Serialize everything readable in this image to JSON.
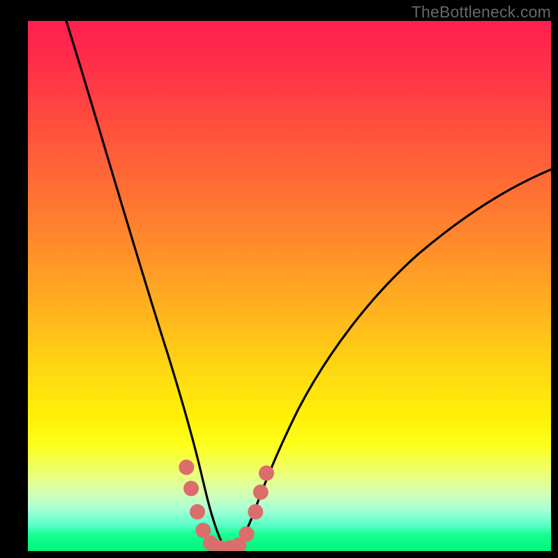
{
  "watermark": "TheBottleneck.com",
  "colors": {
    "page_bg": "#000000",
    "curve": "#000000",
    "marker_fill": "#db6d6d",
    "gradient_stops": [
      "#ff1f4f",
      "#ff2e49",
      "#ff4a3f",
      "#ff6a35",
      "#ff8b2b",
      "#ffb41e",
      "#ffd812",
      "#fff108",
      "#fdff1a",
      "#f4ff4d",
      "#eaff80",
      "#d4ffb3",
      "#a9ffd6",
      "#5cffc9",
      "#14ff8f",
      "#00f57a"
    ]
  },
  "chart_data": {
    "type": "line",
    "title": "",
    "xlabel": "",
    "ylabel": "",
    "xlim": [
      0,
      100
    ],
    "ylim": [
      0,
      100
    ],
    "description": "V-shaped bottleneck curve against a vertical heat-gradient background (red = high bottleneck at top, green = low/no bottleneck at bottom). Two monotone branches descend from the top edge toward a flat minimum near x≈37 at y≈0, with the right branch rising more gently than the left.",
    "series": [
      {
        "name": "left-branch",
        "x": [
          7.3,
          10,
          14,
          18,
          22,
          25,
          27,
          29,
          30.5,
          32,
          33.5,
          35,
          37
        ],
        "y": [
          100,
          90,
          76,
          62,
          48,
          37,
          29,
          21,
          15,
          9,
          4.5,
          1.5,
          0
        ]
      },
      {
        "name": "right-branch",
        "x": [
          40,
          41.5,
          43,
          45,
          48,
          52,
          58,
          66,
          76,
          88,
          100
        ],
        "y": [
          0,
          1.5,
          4,
          8,
          14,
          21,
          30,
          40,
          50,
          58.5,
          65
        ]
      }
    ],
    "markers": {
      "name": "highlighted-region",
      "color": "#db6d6d",
      "points": [
        {
          "x": 30.3,
          "y": 15.8
        },
        {
          "x": 31.2,
          "y": 11.8
        },
        {
          "x": 32.4,
          "y": 7.4
        },
        {
          "x": 33.5,
          "y": 3.9
        },
        {
          "x": 34.9,
          "y": 1.5
        },
        {
          "x": 36.6,
          "y": 0.6
        },
        {
          "x": 38.6,
          "y": 0.6
        },
        {
          "x": 40.3,
          "y": 1.1
        },
        {
          "x": 41.8,
          "y": 3.2
        },
        {
          "x": 43.5,
          "y": 7.4
        },
        {
          "x": 44.5,
          "y": 11.1
        },
        {
          "x": 45.6,
          "y": 14.7
        }
      ]
    }
  }
}
